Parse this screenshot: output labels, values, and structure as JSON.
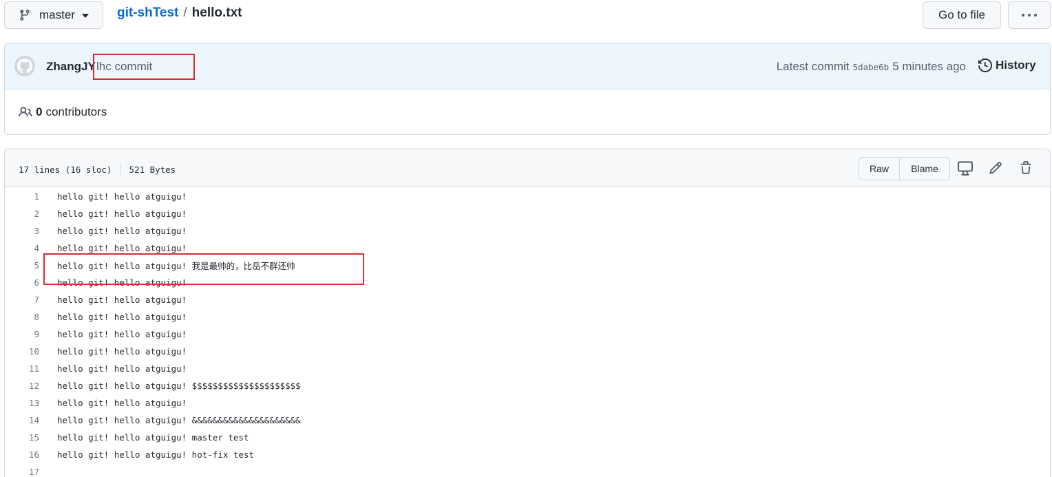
{
  "topbar": {
    "branch": "master",
    "repo": "git-shTest",
    "separator": "/",
    "file": "hello.txt",
    "goto_label": "Go to file"
  },
  "commit": {
    "author": "ZhangJY",
    "message": "lhc commit",
    "latest_label": "Latest commit",
    "sha": "5dabe6b",
    "time": "5 minutes ago",
    "history_label": "History"
  },
  "contributors": {
    "count": "0",
    "label": "contributors"
  },
  "file": {
    "lines_info": "17 lines (16 sloc)",
    "size": "521 Bytes",
    "raw_label": "Raw",
    "blame_label": "Blame",
    "lines": [
      {
        "n": "1",
        "text": "hello git! hello atguigu!"
      },
      {
        "n": "2",
        "text": "hello git! hello atguigu!"
      },
      {
        "n": "3",
        "text": "hello git! hello atguigu!"
      },
      {
        "n": "4",
        "text": "hello git! hello atguigu!"
      },
      {
        "n": "5",
        "text": "hello git! hello atguigu! 我是最帅的，比岳不群还帅"
      },
      {
        "n": "6",
        "text": "hello git! hello atguigu!"
      },
      {
        "n": "7",
        "text": "hello git! hello atguigu!"
      },
      {
        "n": "8",
        "text": "hello git! hello atguigu!"
      },
      {
        "n": "9",
        "text": "hello git! hello atguigu!"
      },
      {
        "n": "10",
        "text": "hello git! hello atguigu!"
      },
      {
        "n": "11",
        "text": "hello git! hello atguigu!"
      },
      {
        "n": "12",
        "text": "hello git! hello atguigu! $$$$$$$$$$$$$$$$$$$$$"
      },
      {
        "n": "13",
        "text": "hello git! hello atguigu!"
      },
      {
        "n": "14",
        "text": "hello git! hello atguigu! &&&&&&&&&&&&&&&&&&&&&"
      },
      {
        "n": "15",
        "text": "hello git! hello atguigu! master test"
      },
      {
        "n": "16",
        "text": "hello git! hello atguigu! hot-fix test"
      },
      {
        "n": "17",
        "text": ""
      }
    ]
  },
  "colors": {
    "link": "#0969da",
    "annotation": "#d32f2f",
    "commit_bg": "#eef6fd"
  }
}
